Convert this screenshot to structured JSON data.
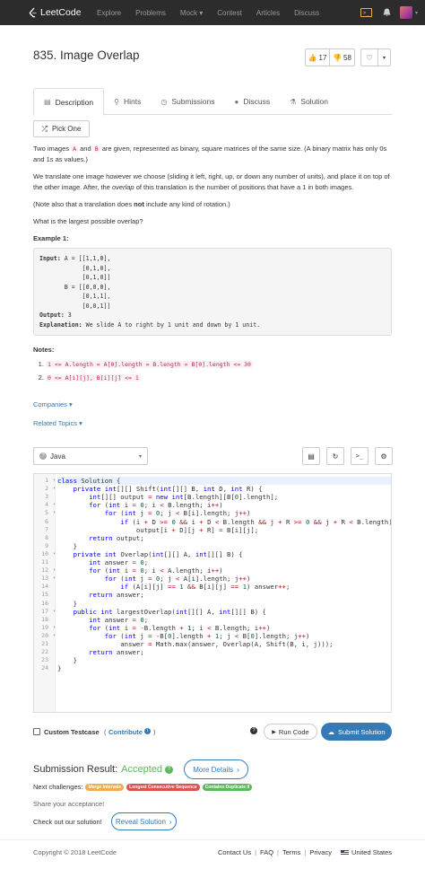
{
  "nav": {
    "brand": "LeetCode",
    "links": [
      "Explore",
      "Problems",
      "Mock ▾",
      "Contest",
      "Articles",
      "Discuss"
    ]
  },
  "problem": {
    "title": "835. Image Overlap",
    "likes": "17",
    "dislikes": "58"
  },
  "tabs": [
    "Description",
    "Hints",
    "Submissions",
    "Discuss",
    "Solution"
  ],
  "pick_one": "Pick One",
  "description": {
    "p1_a": "Two images",
    "p1_A": "A",
    "p1_and": "and",
    "p1_B": "B",
    "p1_b": "are given, represented as binary, square matrices of the same size.  (A binary matrix has only 0s and 1s as values.)",
    "p2_a": "We translate one image however we choose (sliding it left, right, up, or down any number of units), and place it on top of the other image.  After, the",
    "p2_em": "overlap",
    "p2_b": "of this translation is the number of positions that have a 1 in both images.",
    "p3_a": "(Note also that a translation does",
    "p3_strong": "not",
    "p3_b": "include any kind of rotation.)",
    "p4": "What is the largest possible overlap?",
    "example_title": "Example 1:",
    "ex_input_label": "Input:",
    "ex_input_text": " A = [[1,1,0],\n            [0,1,0],\n            [0,1,0]]\n       B = [[0,0,0],\n            [0,1,1],\n            [0,0,1]]",
    "ex_output_label": "Output:",
    "ex_output_text": " 3",
    "ex_expl_label": "Explanation:",
    "ex_expl_text": " We slide A to right by 1 unit and down by 1 unit.",
    "notes_title": "Notes:",
    "notes": [
      "1 <= A.length = A[0].length = B.length = B[0].length <= 30",
      "0 <= A[i][j], B[i][j] <= 1"
    ],
    "companies": "Companies ▾",
    "related": "Related Topics ▾"
  },
  "editor": {
    "language": "Java",
    "lines": [
      "class Solution {",
      "    private int[][] Shift(int[][] B, int D, int R) {",
      "        int[][] output = new int[B.length][B[0].length];",
      "        for (int i = 0; i < B.length; i++)",
      "            for (int j = 0; j < B[i].length; j++)",
      "                if (i + D >= 0 && i + D < B.length && j + R >= 0 && j + R < B.length)",
      "                    output[i + D][j + R] = B[i][j];",
      "        return output;",
      "    }",
      "    private int Overlap(int[][] A, int[][] B) {",
      "        int answer = 0;",
      "        for (int i = 0; i < A.length; i++)",
      "            for (int j = 0; j < A[i].length; j++)",
      "                if (A[i][j] == 1 && B[i][j] == 1) answer++;",
      "        return answer;",
      "    }",
      "    public int largestOverlap(int[][] A, int[][] B) {",
      "        int answer = 0;",
      "        for (int i = -B.length + 1; i < B.length; i++)",
      "            for (int j = -B[0].length + 1; j < B[0].length; j++)",
      "                answer = Math.max(answer, Overlap(A, Shift(B, i, j)));",
      "        return answer;",
      "    }",
      "}"
    ]
  },
  "actions": {
    "custom_testcase": "Custom Testcase",
    "contribute": "Contribute",
    "run_code": "Run Code",
    "submit": "Submit Solution"
  },
  "result": {
    "label": "Submission Result:",
    "status": "Accepted",
    "more": "More Details",
    "next_label": "Next challenges:",
    "challenges": [
      {
        "name": "Merge Intervals",
        "color": "#f0ad4e"
      },
      {
        "name": "Longest Consecutive Sequence",
        "color": "#d9534f"
      },
      {
        "name": "Contains Duplicate II",
        "color": "#5cb85c"
      }
    ],
    "share": "Share your acceptance!",
    "checkout": "Check out our solution!",
    "reveal": "Reveal Solution"
  },
  "footer": {
    "copyright": "Copyright © 2018 LeetCode",
    "contact": "Contact Us",
    "faq": "FAQ",
    "terms": "Terms",
    "privacy": "Privacy",
    "region": "United States"
  },
  "colors": {
    "accent": "#337ab7",
    "accepted": "#5cb85c",
    "navbar": "#2c2c2c"
  }
}
